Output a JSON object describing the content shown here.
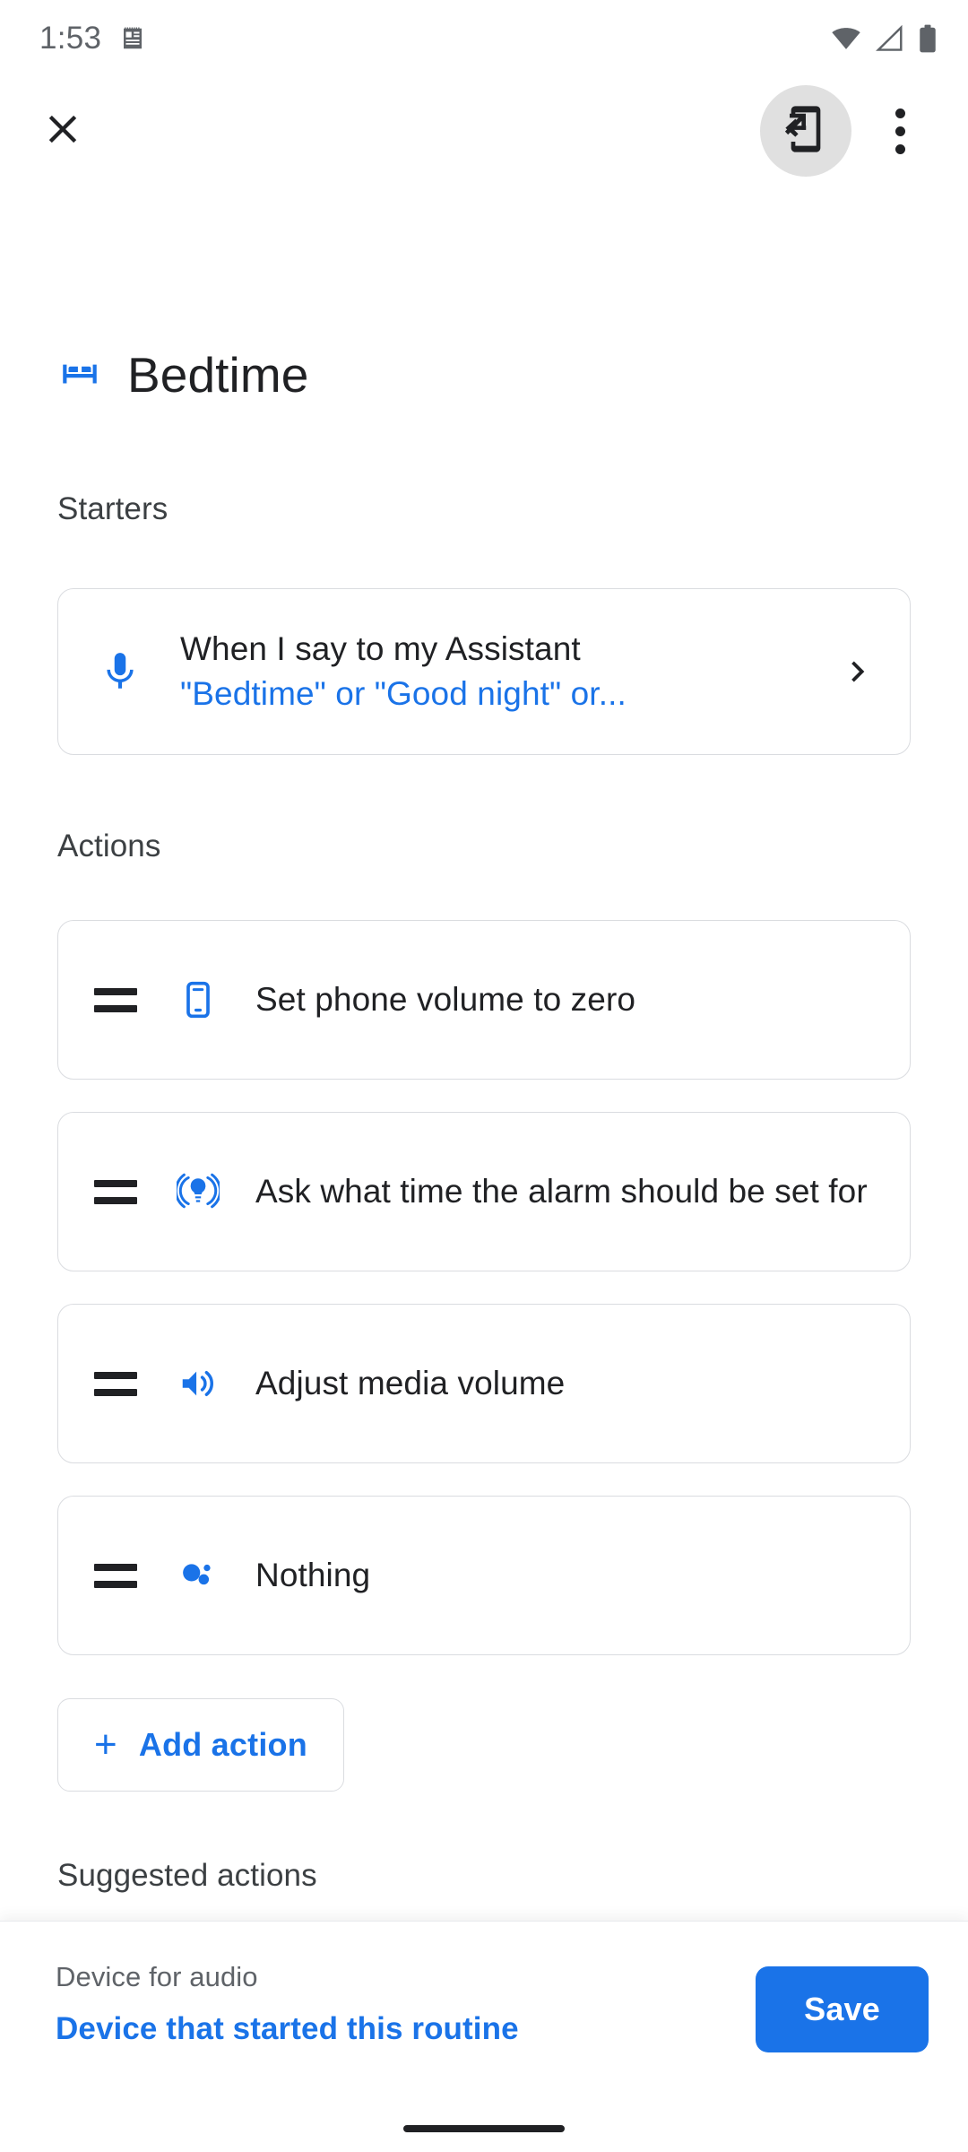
{
  "status_bar": {
    "time": "1:53",
    "icons": [
      "notes-icon",
      "wifi-icon",
      "signal-icon",
      "battery-icon"
    ]
  },
  "toolbar": {
    "close_icon": "close-icon",
    "share_to_device_icon": "mobile-screen-share-icon",
    "overflow_icon": "more-vert-icon"
  },
  "routine": {
    "icon": "bed-icon",
    "title": "Bedtime"
  },
  "starters": {
    "section_label": "Starters",
    "items": [
      {
        "icon": "microphone-icon",
        "title": "When I say to my Assistant",
        "subtitle": "\"Bedtime\" or \"Good night\" or...",
        "chevron": "chevron-right-icon"
      }
    ]
  },
  "actions": {
    "section_label": "Actions",
    "items": [
      {
        "icon": "phone-icon",
        "label": "Set phone volume to zero"
      },
      {
        "icon": "broadcast-icon",
        "label": "Ask what time the alarm should be set for"
      },
      {
        "icon": "volume-up-icon",
        "label": "Adjust media volume"
      },
      {
        "icon": "assistant-icon",
        "label": "Nothing"
      }
    ],
    "add_action_label": "Add action",
    "add_icon": "plus-icon"
  },
  "suggested": {
    "section_label": "Suggested actions"
  },
  "bottom_bar": {
    "audio_label": "Device for audio",
    "audio_value": "Device that started this routine",
    "save_label": "Save"
  },
  "colors": {
    "accent_blue": "#1a73e8",
    "text_primary": "#202124",
    "text_secondary": "#5f6368",
    "card_border": "#dadce0"
  }
}
